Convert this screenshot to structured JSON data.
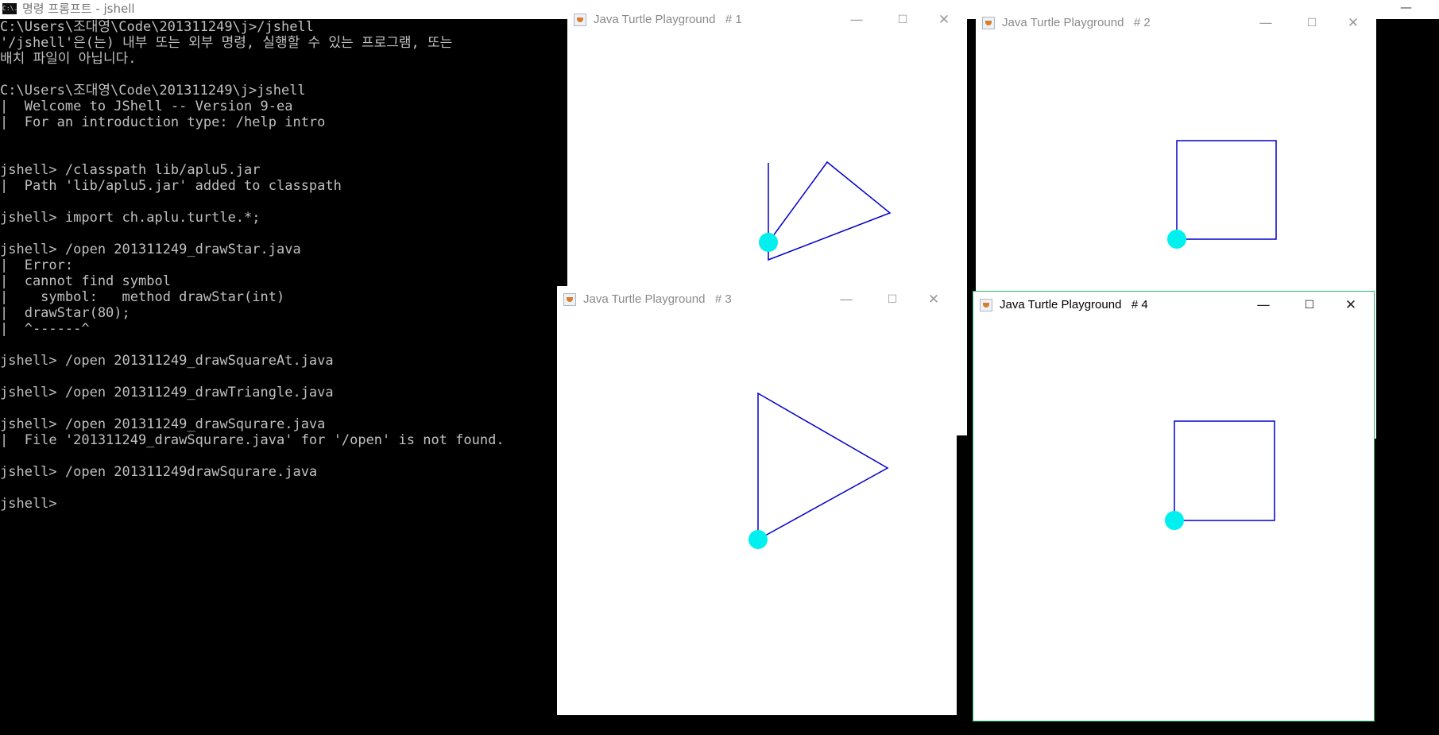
{
  "console": {
    "icon": "C:\\.",
    "title": "명령 프롬프트 - jshell",
    "minimize": "—",
    "lines": [
      "C:\\Users\\조대영\\Code\\201311249\\j>/jshell",
      "'/jshell'은(는) 내부 또는 외부 명령, 실행할 수 있는 프로그램, 또는",
      "배치 파일이 아닙니다.",
      "",
      "C:\\Users\\조대영\\Code\\201311249\\j>jshell",
      "|  Welcome to JShell -- Version 9-ea",
      "|  For an introduction type: /help intro",
      "",
      "",
      "jshell> /classpath lib/aplu5.jar",
      "|  Path 'lib/aplu5.jar' added to classpath",
      "",
      "jshell> import ch.aplu.turtle.*;",
      "",
      "jshell> /open 201311249_drawStar.java",
      "|  Error:",
      "|  cannot find symbol",
      "|    symbol:   method drawStar(int)",
      "|  drawStar(80);",
      "|  ^------^",
      "",
      "jshell> /open 201311249_drawSquareAt.java",
      "",
      "jshell> /open 201311249_drawTriangle.java",
      "",
      "jshell> /open 201311249_drawSqurare.java",
      "|  File '201311249_drawSqurare.java' for '/open' is not found.",
      "",
      "jshell> /open 201311249drawSqurare.java",
      "",
      "jshell>"
    ]
  },
  "windows": [
    {
      "title": "Java Turtle Playground   # 1",
      "controls": {
        "minimize": "—",
        "maximize": "☐",
        "close": "✕"
      }
    },
    {
      "title": "Java Turtle Playground   # 2",
      "controls": {
        "minimize": "—",
        "maximize": "☐",
        "close": "✕"
      }
    },
    {
      "title": "Java Turtle Playground   # 3",
      "controls": {
        "minimize": "—",
        "maximize": "☐",
        "close": "✕"
      }
    },
    {
      "title": "Java Turtle Playground   # 4",
      "controls": {
        "minimize": "—",
        "maximize": "☐",
        "close": "✕"
      }
    }
  ],
  "colors": {
    "turtle": "#00f0f0",
    "trail": "#0000cc",
    "active_border": "#2ab573"
  }
}
